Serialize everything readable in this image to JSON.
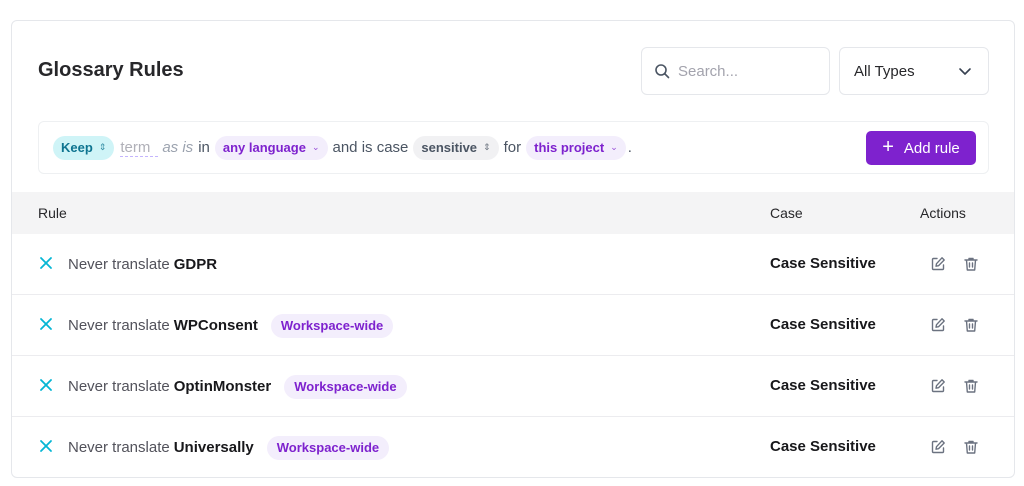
{
  "header": {
    "title": "Glossary Rules"
  },
  "search": {
    "placeholder": "Search..."
  },
  "type_filter": {
    "selected": "All Types"
  },
  "builder": {
    "keep_label": "Keep",
    "term_placeholder": "term",
    "as_is": "as is",
    "in_text": "in",
    "language_value": "any language",
    "case_text": "and is case",
    "case_value": "sensitive",
    "for_text": "for",
    "scope_value": "this project",
    "period": ".",
    "add_rule_label": "Add rule"
  },
  "table": {
    "columns": {
      "rule": "Rule",
      "case": "Case",
      "actions": "Actions"
    },
    "rows": [
      {
        "prefix": "Never translate",
        "term": "GDPR",
        "badge": "",
        "case": "Case Sensitive"
      },
      {
        "prefix": "Never translate",
        "term": "WPConsent",
        "badge": "Workspace-wide",
        "case": "Case Sensitive"
      },
      {
        "prefix": "Never translate",
        "term": "OptinMonster",
        "badge": "Workspace-wide",
        "case": "Case Sensitive"
      },
      {
        "prefix": "Never translate",
        "term": "Universally",
        "badge": "Workspace-wide",
        "case": "Case Sensitive"
      }
    ]
  },
  "icons": {
    "search": "search-icon",
    "chevron": "chevron-down-icon",
    "plus": "plus-icon",
    "remove": "close-icon",
    "edit": "edit-icon",
    "delete": "trash-icon"
  },
  "colors": {
    "accent": "#7e22ce",
    "keep": "#0e7490",
    "x_icon": "#06b6d4"
  }
}
